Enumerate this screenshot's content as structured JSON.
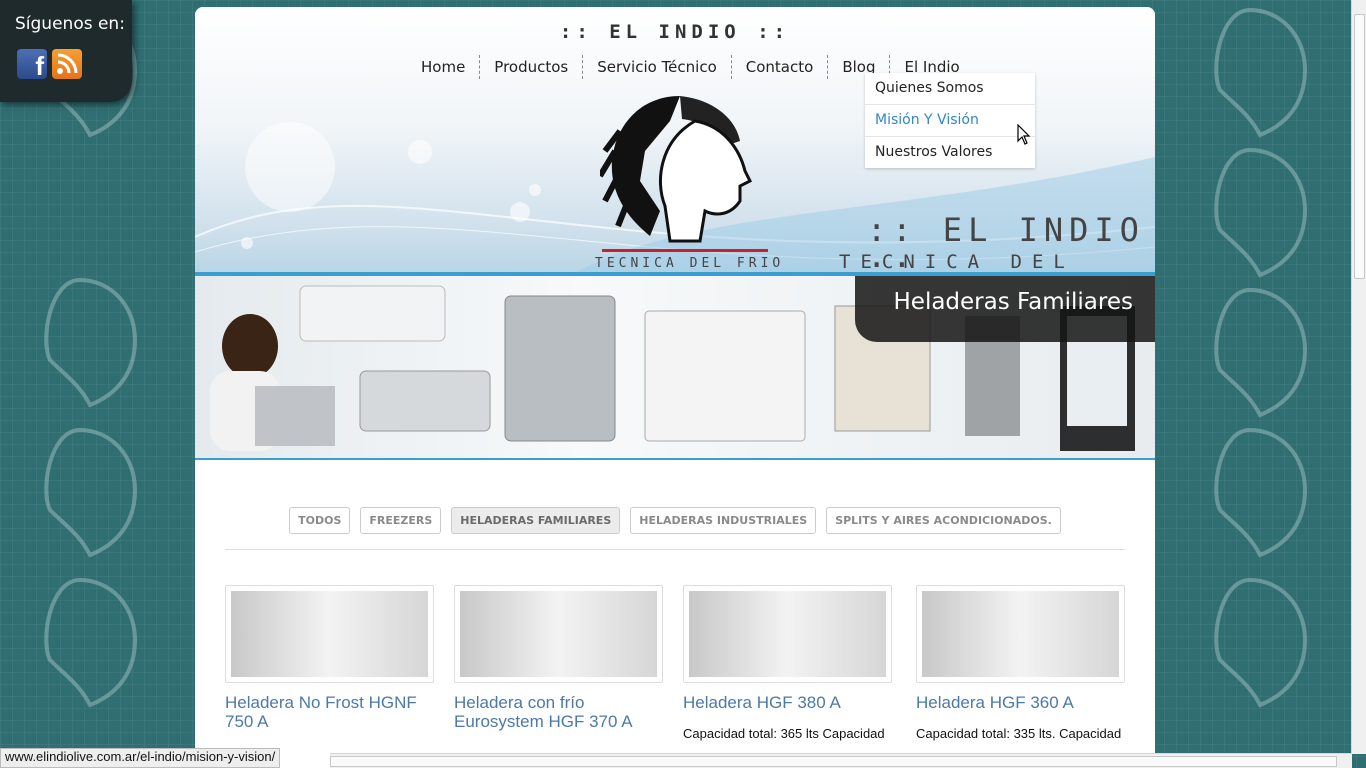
{
  "social": {
    "title": "Síguenos en:",
    "icons": [
      "facebook-icon",
      "rss-icon"
    ]
  },
  "header": {
    "top_logo": ":: EL INDIO ::",
    "logo_title": ":: EL INDIO ::",
    "logo_subtitle": "TECNICA DEL FRIO",
    "logo_small_tagline": "TECNICA DEL FRIO"
  },
  "nav": {
    "items": [
      "Home",
      "Productos",
      "Servicio Técnico",
      "Contacto",
      "Blog",
      "El Indio"
    ],
    "dropdown": {
      "items": [
        "Quienes Somos",
        "Misión Y Visión",
        "Nuestros Valores"
      ],
      "active": "Misión Y Visión"
    }
  },
  "banner": {
    "caption": "Heladeras Familiares"
  },
  "filters": {
    "items": [
      "TODOS",
      "FREEZERS",
      "HELADERAS FAMILIARES",
      "HELADERAS INDUSTRIALES",
      "SPLITS Y AIRES ACONDICIONADOS."
    ],
    "active": "HELADERAS FAMILIARES"
  },
  "products": [
    {
      "title": "Heladera No Frost HGNF 750 A",
      "desc": ""
    },
    {
      "title": "Heladera con frío Eurosystem HGF 370 A",
      "desc": ""
    },
    {
      "title": "Heladera HGF 380 A",
      "desc": "Capacidad total: 365 lts Capacidad"
    },
    {
      "title": "Heladera HGF 360 A",
      "desc": "Capacidad total: 335 lts. Capacidad"
    }
  ],
  "statusbar": {
    "url": "www.elindiolive.com.ar/el-indio/mision-y-vision/"
  },
  "colors": {
    "background": "#2f6f72",
    "accent": "#3a9fd0",
    "link": "#4b7aa8",
    "menu_active": "#2f88c5"
  }
}
